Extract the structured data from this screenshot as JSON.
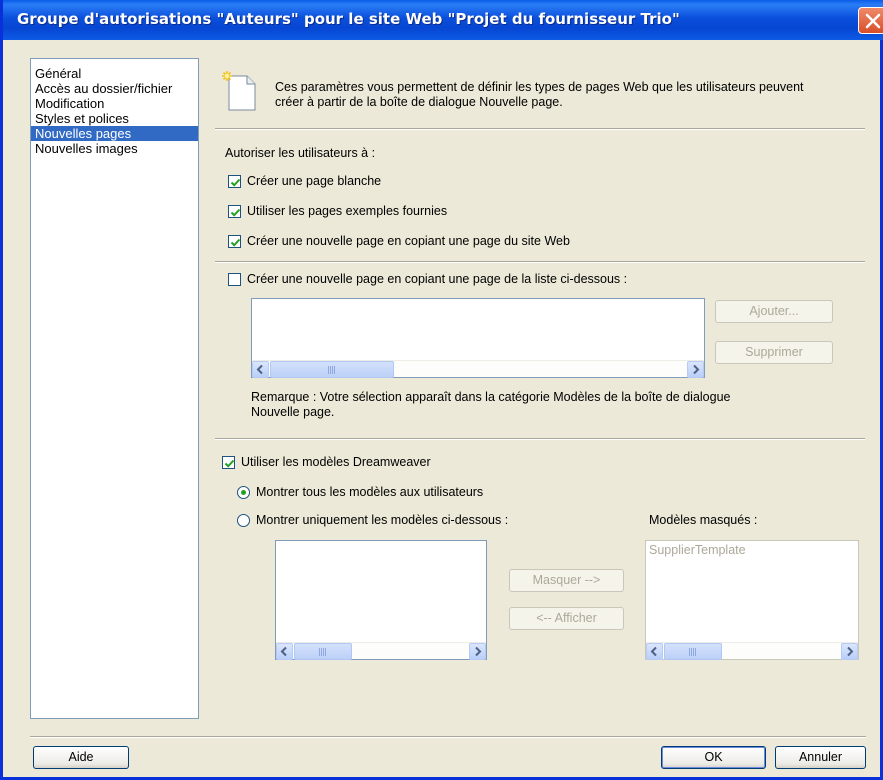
{
  "window": {
    "title": "Groupe d'autorisations \"Auteurs\" pour le site Web \"Projet du fournisseur Trio\""
  },
  "categories": [
    {
      "label": "Général",
      "selected": false
    },
    {
      "label": "Accès au dossier/fichier",
      "selected": false
    },
    {
      "label": "Modification",
      "selected": false
    },
    {
      "label": "Styles et polices",
      "selected": false
    },
    {
      "label": "Nouvelles pages",
      "selected": true
    },
    {
      "label": "Nouvelles images",
      "selected": false
    }
  ],
  "header": {
    "icon": "new-page-icon",
    "text": "Ces paramètres vous permettent de définir les types de pages Web que les utilisateurs peuvent créer à partir de la boîte de dialogue Nouvelle page."
  },
  "allow": {
    "label": "Autoriser les utilisateurs à :",
    "blank_page": {
      "label": "Créer une page blanche",
      "checked": true
    },
    "sample_pages": {
      "label": "Utiliser les pages exemples fournies",
      "checked": true
    },
    "copy_site_page": {
      "label": "Créer une nouvelle page en copiant une page du site Web",
      "checked": true
    }
  },
  "copy_list": {
    "label": "Créer une nouvelle page en copiant une page de la liste ci-dessous :",
    "checked": false,
    "add_button": "Ajouter...",
    "remove_button": "Supprimer",
    "note": "Remarque : Votre sélection apparaît dans la catégorie Modèles de la boîte de dialogue Nouvelle page."
  },
  "templates": {
    "use_label": "Utiliser les modèles Dreamweaver",
    "use_checked": true,
    "show_all": {
      "label": "Montrer tous les modèles aux utilisateurs",
      "selected": true
    },
    "show_only": {
      "label": "Montrer uniquement les modèles ci-dessous :",
      "selected": false
    },
    "hidden_label": "Modèles masqués :",
    "hidden_items": [
      "SupplierTemplate"
    ],
    "hide_button": "Masquer -->",
    "show_button": "<-- Afficher"
  },
  "footer": {
    "help_button": "Aide",
    "ok_button": "OK",
    "cancel_button": "Annuler"
  }
}
